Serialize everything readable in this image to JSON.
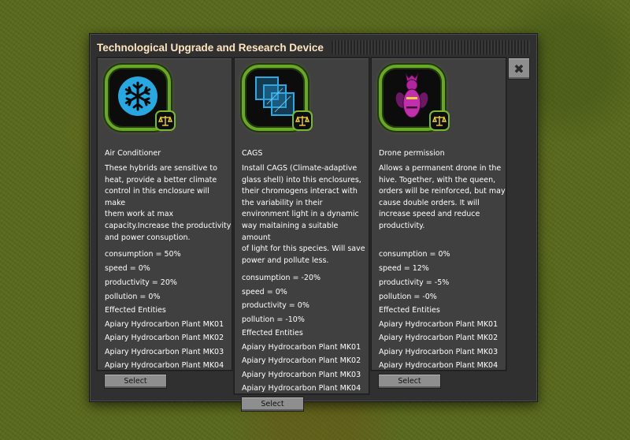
{
  "window": {
    "title": "Technological Upgrade and Research Device",
    "close_glyph": "✖"
  },
  "cards": [
    {
      "name": "Air Conditioner",
      "icon": "snowflake-icon",
      "description": [
        "These hybrids are sensitive to",
        "heat, provide a better climate",
        "control in this enclosure will make",
        "them work at max",
        "capacity.Increase the productivity",
        "and power consuption."
      ],
      "stats": [
        "consumption = 50%",
        "speed = 0%",
        "productivity = 20%",
        "pollution = 0%"
      ],
      "entities_header": "Effected Entities",
      "entities": [
        "Apiary Hydrocarbon Plant MK01",
        "Apiary Hydrocarbon Plant MK02",
        "Apiary Hydrocarbon Plant MK03",
        "Apiary Hydrocarbon Plant MK04"
      ],
      "select_label": "Select"
    },
    {
      "name": "CAGS",
      "icon": "glass-panes-icon",
      "description": [
        "Install CAGS (Climate-adaptive",
        "glass shell) into this enclosures,",
        "their chromogens interact with",
        "the variability in their",
        "environment light in a dynamic",
        "way maitaining a suitable amount",
        "of light for this species. Will save",
        "power and pollute less."
      ],
      "stats": [
        "consumption = -20%",
        "speed = 0%",
        "productivity = 0%",
        "pollution = -10%"
      ],
      "entities_header": "Effected Entities",
      "entities": [
        "Apiary Hydrocarbon Plant MK01",
        "Apiary Hydrocarbon Plant MK02",
        "Apiary Hydrocarbon Plant MK03",
        "Apiary Hydrocarbon Plant MK04"
      ],
      "select_label": "Select"
    },
    {
      "name": "Drone permission",
      "icon": "drone-bee-icon",
      "description": [
        "Allows a permanent drone in the",
        "hive. Together, with the queen,",
        "orders will be reinforced, but may",
        "cause double orders. It will",
        "increase speed and reduce",
        "productivity."
      ],
      "stats": [
        "consumption = 0%",
        "speed = 12%",
        "productivity = -5%",
        "pollution = -0%"
      ],
      "entities_header": "Effected Entities",
      "entities": [
        "Apiary Hydrocarbon Plant MK01",
        "Apiary Hydrocarbon Plant MK02",
        "Apiary Hydrocarbon Plant MK03",
        "Apiary Hydrocarbon Plant MK04"
      ],
      "select_label": "Select"
    }
  ],
  "colors": {
    "accent_green": "#6aa62a",
    "panel": "#414040",
    "title": "#ffe6c0"
  }
}
